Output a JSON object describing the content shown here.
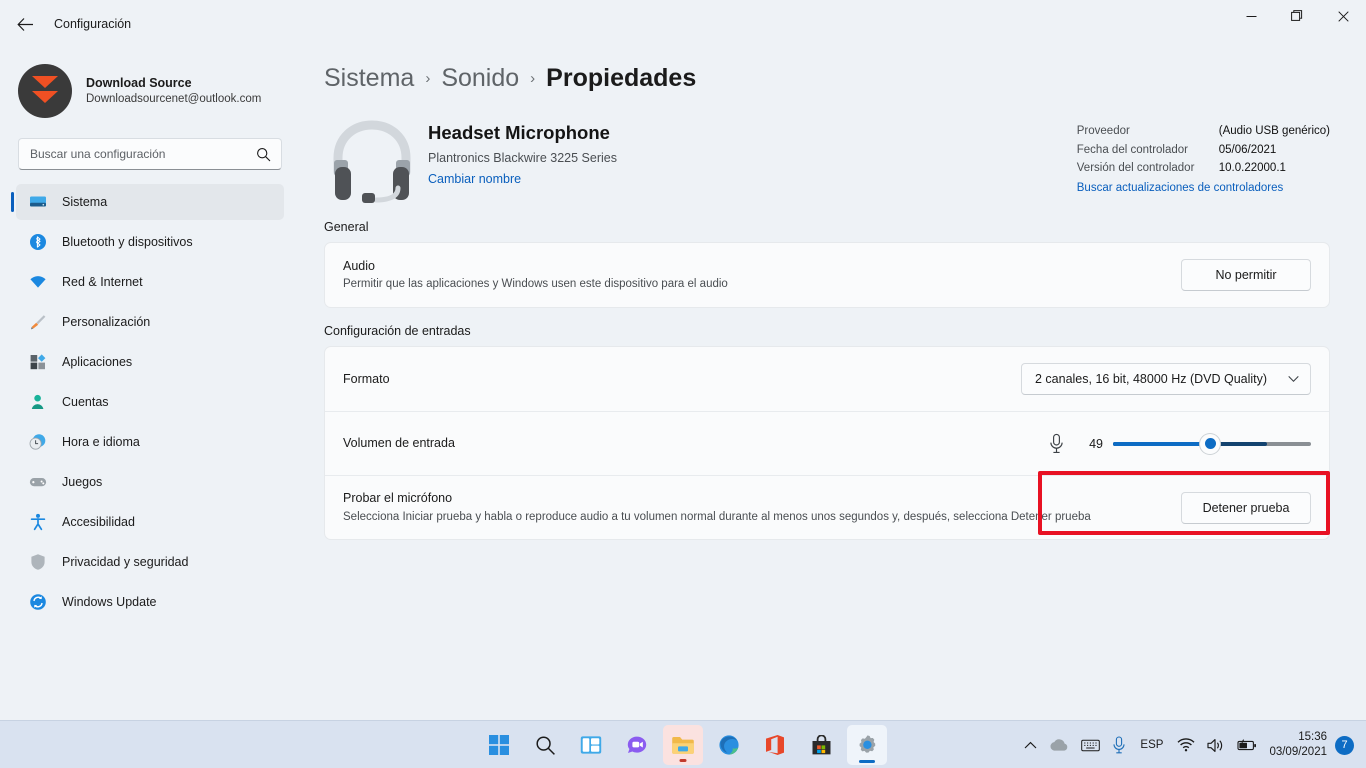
{
  "window": {
    "title": "Configuración",
    "back_icon": "arrow-left-icon",
    "minimize_label": "—",
    "maximize_label": "▢",
    "close_label": "✕"
  },
  "sidebar": {
    "profile": {
      "name": "Download Source",
      "email": "Downloadsourcenet@outlook.com"
    },
    "search": {
      "placeholder": "Buscar una configuración",
      "value": "",
      "icon": "search-icon"
    },
    "items": [
      {
        "label": "Sistema",
        "icon": "system-monitor-icon",
        "active": true
      },
      {
        "label": "Bluetooth y dispositivos",
        "icon": "bluetooth-icon",
        "active": false
      },
      {
        "label": "Red & Internet",
        "icon": "wifi-icon",
        "active": false
      },
      {
        "label": "Personalización",
        "icon": "paintbrush-icon",
        "active": false
      },
      {
        "label": "Aplicaciones",
        "icon": "apps-icon",
        "active": false
      },
      {
        "label": "Cuentas",
        "icon": "person-icon",
        "active": false
      },
      {
        "label": "Hora e idioma",
        "icon": "clock-globe-icon",
        "active": false
      },
      {
        "label": "Juegos",
        "icon": "gamepad-icon",
        "active": false
      },
      {
        "label": "Accesibilidad",
        "icon": "accessibility-icon",
        "active": false
      },
      {
        "label": "Privacidad y seguridad",
        "icon": "shield-icon",
        "active": false
      },
      {
        "label": "Windows Update",
        "icon": "update-icon",
        "active": false
      }
    ]
  },
  "breadcrumb": {
    "items": [
      "Sistema",
      "Sonido",
      "Propiedades"
    ],
    "separator": "›"
  },
  "device": {
    "icon": "headset-icon",
    "name": "Headset Microphone",
    "model": "Plantronics Blackwire 3225 Series",
    "rename_link": "Cambiar nombre"
  },
  "driver_info": {
    "rows": [
      {
        "key": "Proveedor",
        "value": "(Audio USB genérico)"
      },
      {
        "key": "Fecha del controlador",
        "value": "05/06/2021"
      },
      {
        "key": "Versión del controlador",
        "value": "10.0.22000.1"
      }
    ],
    "update_link": "Buscar actualizaciones de controladores"
  },
  "general": {
    "section_title": "General",
    "audio": {
      "title": "Audio",
      "description": "Permitir que las aplicaciones y Windows usen este dispositivo para el audio",
      "button_label": "No permitir"
    }
  },
  "input_settings": {
    "section_title": "Configuración de entradas",
    "format": {
      "title": "Formato",
      "selected": "2 canales, 16 bit, 48000 Hz (DVD Quality)",
      "chevron": "chevron-down-icon"
    },
    "volume": {
      "title": "Volumen de entrada",
      "icon": "microphone-icon",
      "value": "49",
      "min": 0,
      "max": 100,
      "fill_percent": 49,
      "peak_percent": 78,
      "highlighted": true,
      "highlight_color": "#e81123"
    },
    "test": {
      "title": "Probar el micrófono",
      "description": "Selecciona Iniciar prueba y habla o reproduce audio a tu volumen normal durante al menos unos segundos y, después, selecciona Detener prueba",
      "button_label": "Detener prueba"
    }
  },
  "taskbar": {
    "buttons": [
      {
        "name": "start",
        "icon": "windows-logo-icon"
      },
      {
        "name": "search",
        "icon": "search-icon"
      },
      {
        "name": "task-view",
        "icon": "task-view-icon"
      },
      {
        "name": "chat",
        "icon": "chat-icon"
      },
      {
        "name": "file-explorer",
        "icon": "folder-icon"
      },
      {
        "name": "edge",
        "icon": "edge-icon"
      },
      {
        "name": "office",
        "icon": "office-icon"
      },
      {
        "name": "store",
        "icon": "store-icon"
      },
      {
        "name": "settings",
        "icon": "gear-icon"
      }
    ],
    "tray": {
      "overflow_icon": "chevron-up-icon",
      "onedrive_icon": "cloud-icon",
      "keyboard_icon": "keyboard-icon",
      "microphone_icon": "microphone-icon",
      "language": "ESP",
      "wifi_icon": "wifi-icon",
      "volume_icon": "speaker-icon",
      "battery_icon": "battery-icon",
      "time": "15:36",
      "date": "03/09/2021",
      "notification_count": "7"
    }
  },
  "colors": {
    "accent": "#0d6cc4",
    "highlight": "#e81123",
    "page_bg": "#eef2f6",
    "card_bg": "#fafbfc"
  }
}
